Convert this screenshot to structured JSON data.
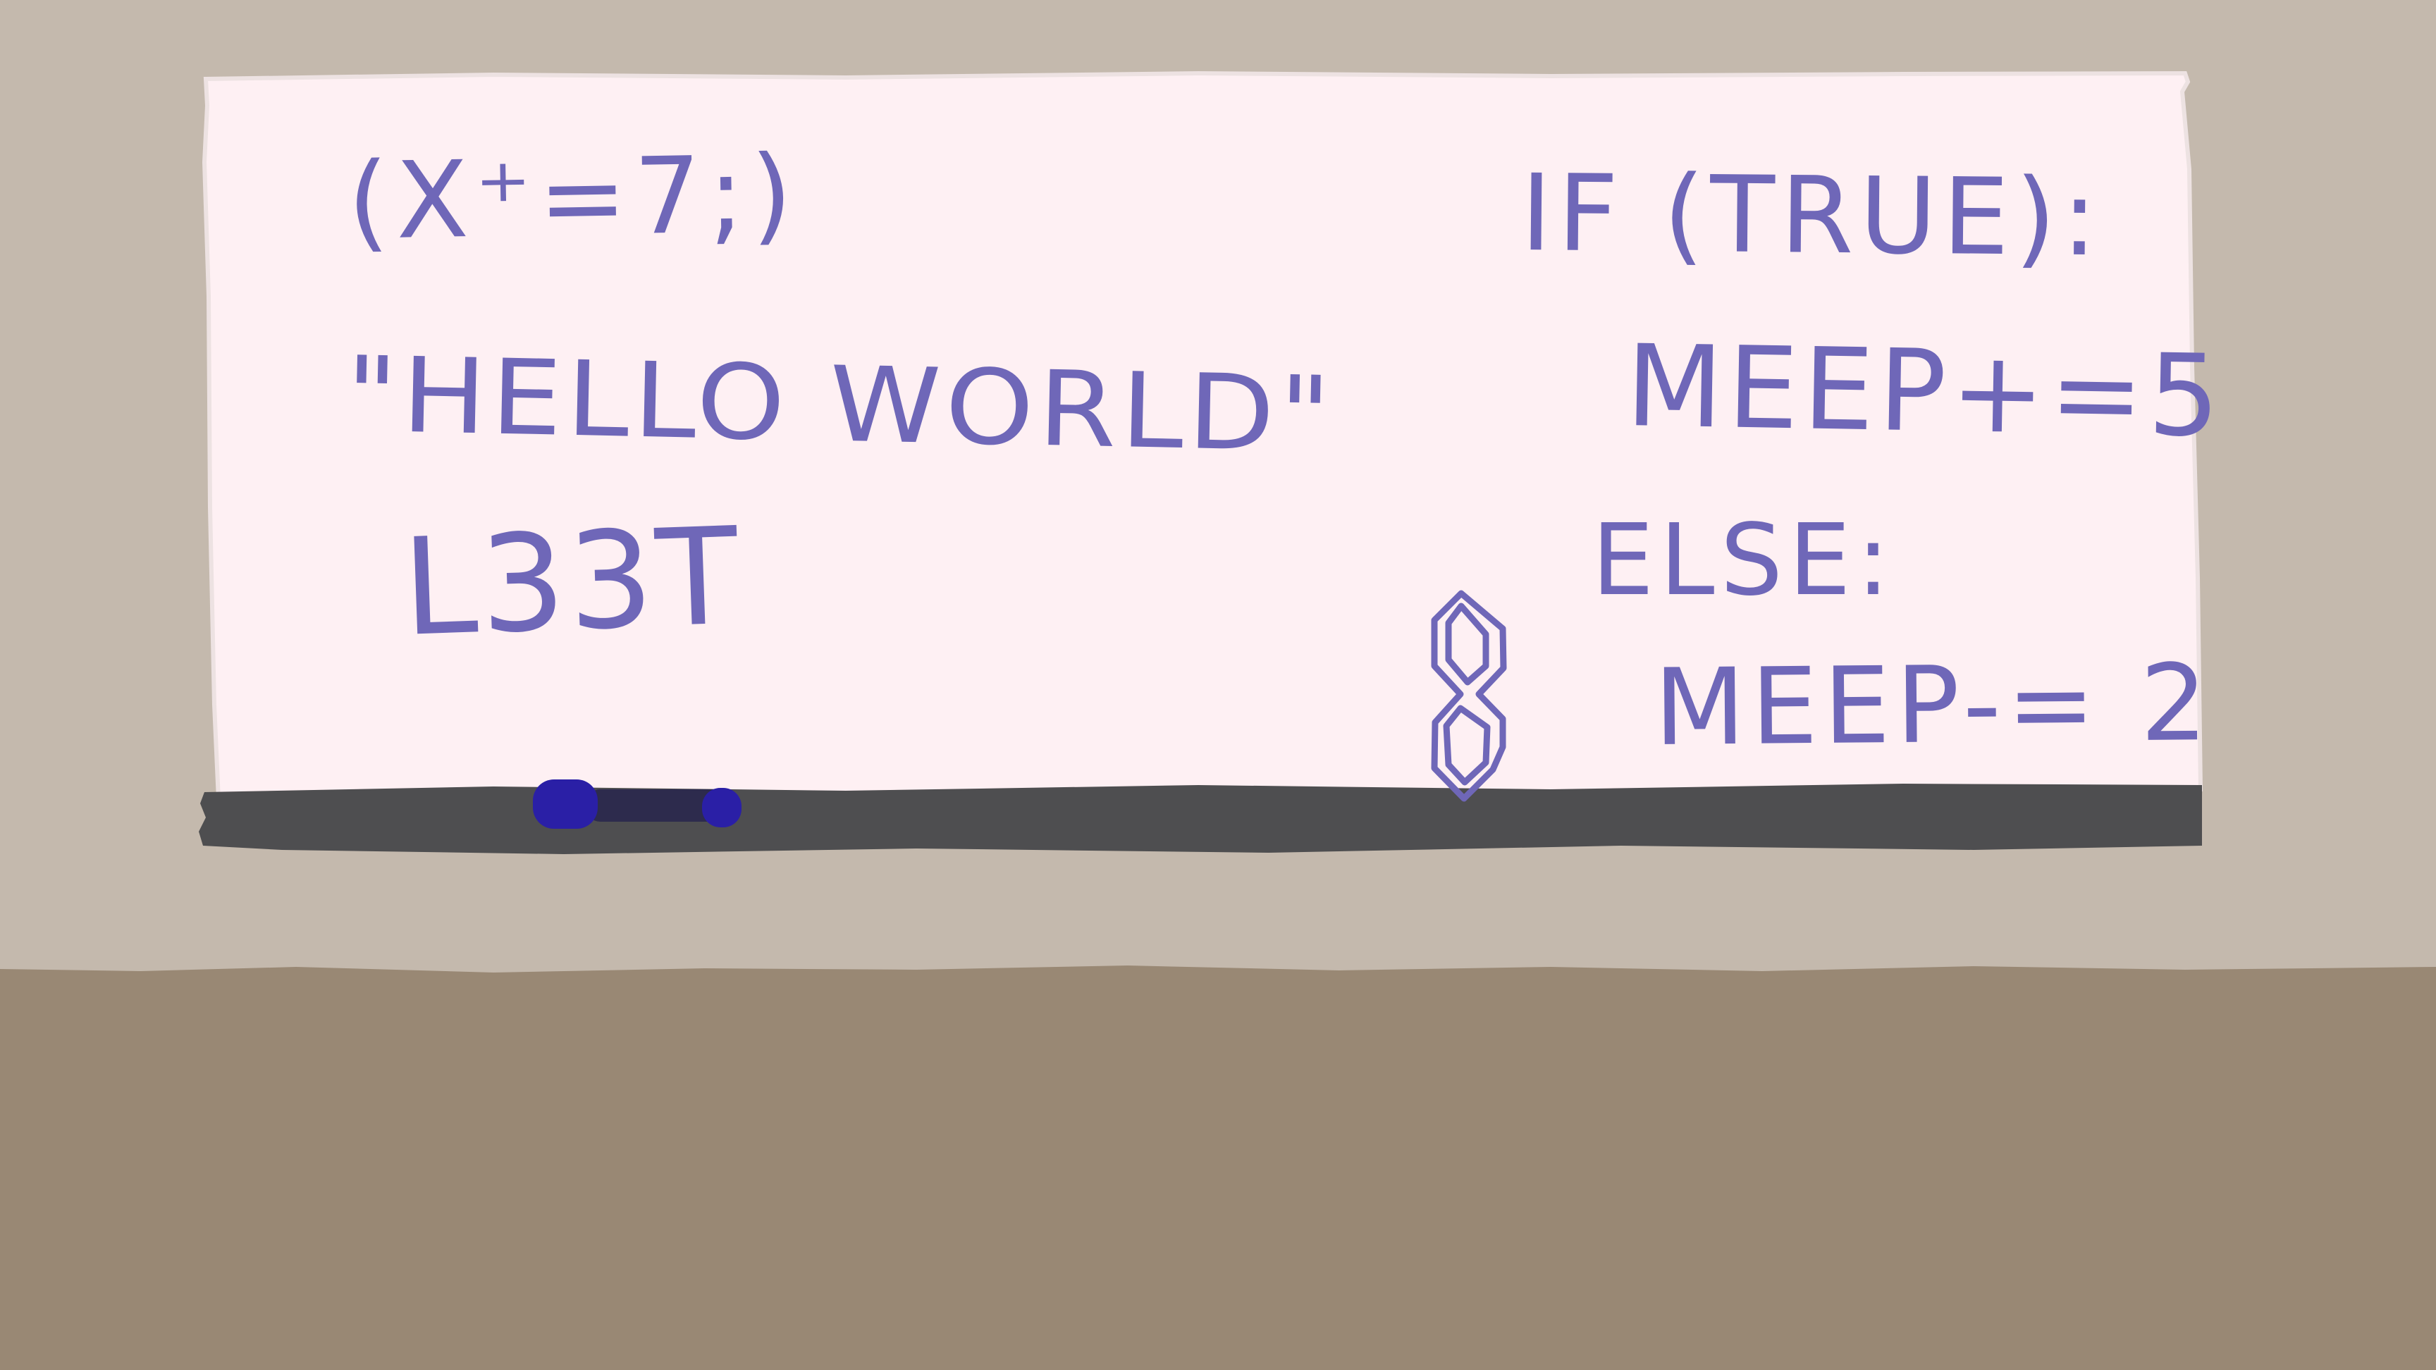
{
  "scene": {
    "colors": {
      "wall": "#c4b9ad",
      "floor": "#998874",
      "board": "#fef0f3",
      "board_edge": "#ede2e2",
      "tray": "#4e4e50",
      "marker_ink": "#6f67b8",
      "marker_cap": "#2a1fa6",
      "marker_body": "#2d2b4d"
    },
    "icons": [
      "whiteboard",
      "whiteboard-tray",
      "marker-icon",
      "s-doodle-icon"
    ]
  },
  "whiteboard": {
    "left_column": {
      "line1": "(X⁺=7;)",
      "line2": "\"HELLO WORLD\"",
      "line3": "L33T"
    },
    "right_column": {
      "line1": "IF (TRUE):",
      "line2": "MEEP+=5",
      "line3": "ELSE:",
      "line4": "MEEP-= 2"
    }
  }
}
